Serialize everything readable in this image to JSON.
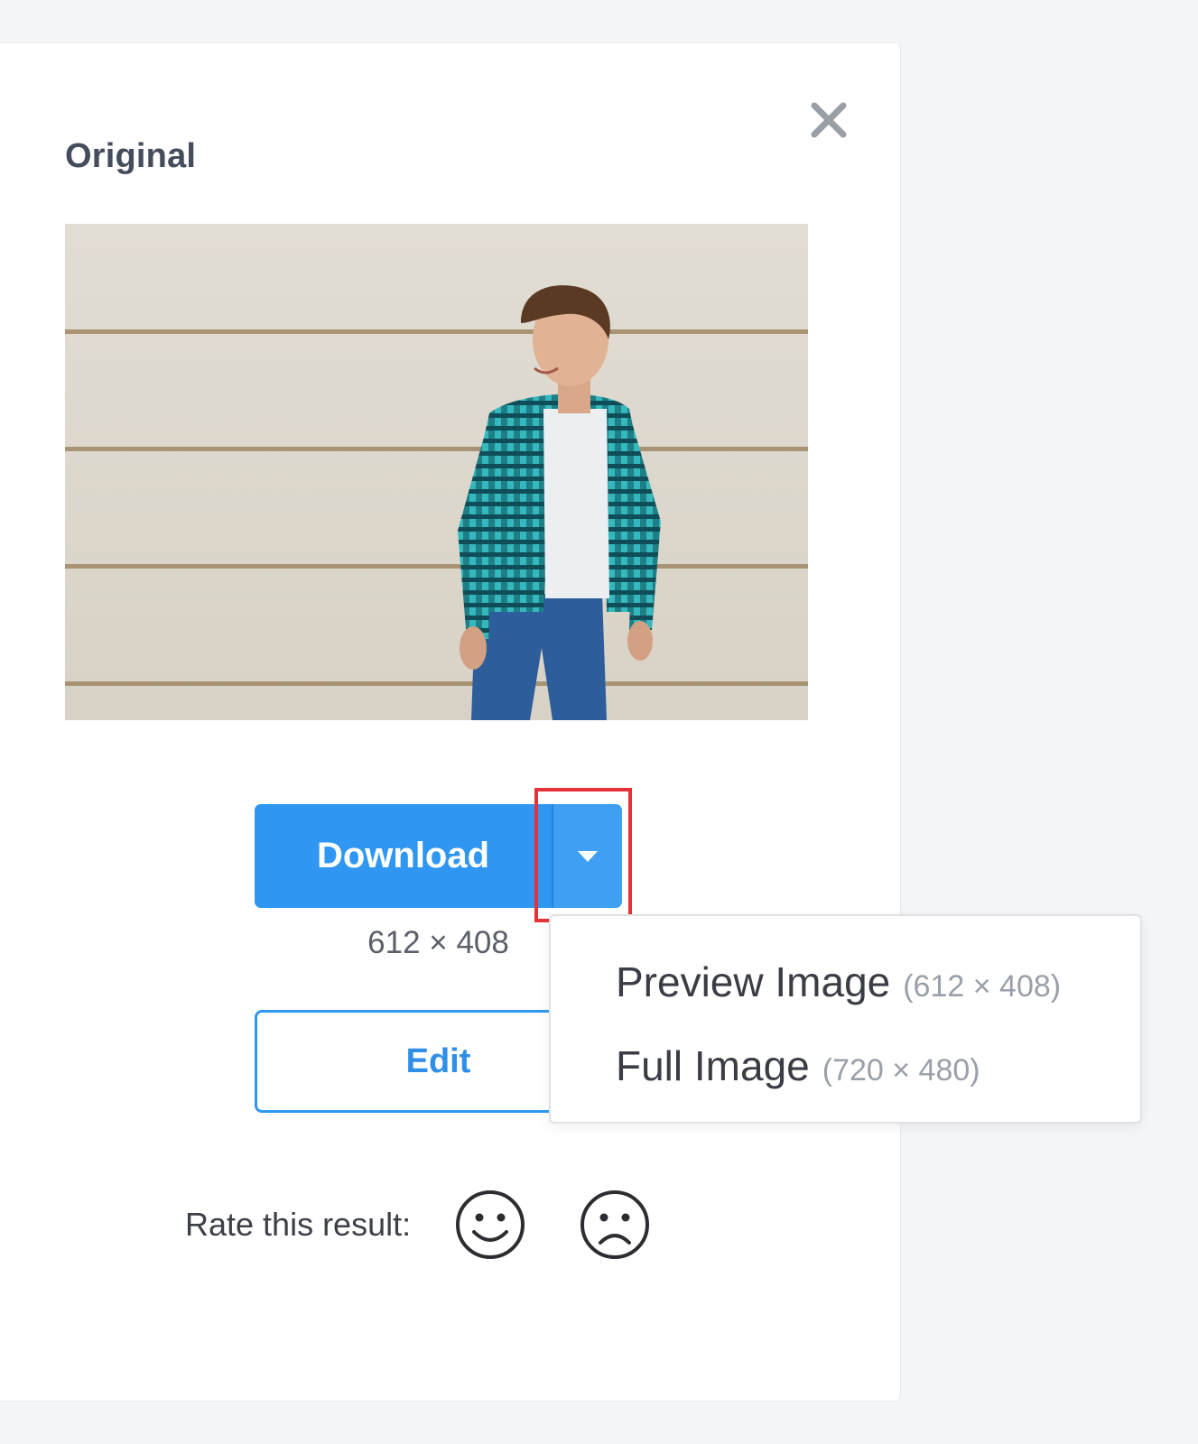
{
  "panel": {
    "title": "Original",
    "close_icon": "close-icon"
  },
  "download": {
    "label": "Download",
    "toggle_icon": "caret-down-icon",
    "dimensions": "612 × 408",
    "menu": [
      {
        "label": "Preview Image",
        "size": "(612 × 408)"
      },
      {
        "label": "Full Image",
        "size": "(720 × 480)"
      }
    ]
  },
  "edit": {
    "label": "Edit"
  },
  "rating": {
    "label": "Rate this result:",
    "positive_icon": "smiley-face-icon",
    "negative_icon": "sad-face-icon"
  },
  "colors": {
    "accent": "#2f97f2",
    "highlight": "#e53238"
  }
}
